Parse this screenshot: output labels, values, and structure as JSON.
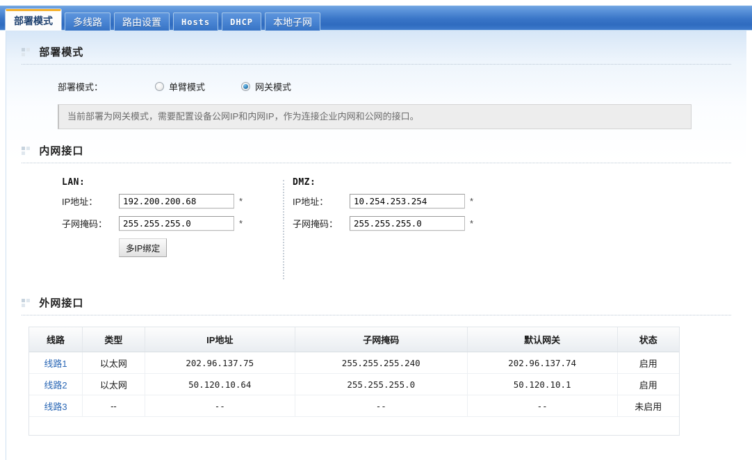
{
  "tabs": [
    {
      "label": "部署模式",
      "active": true,
      "ascii": false
    },
    {
      "label": "多线路",
      "active": false,
      "ascii": false
    },
    {
      "label": "路由设置",
      "active": false,
      "ascii": false
    },
    {
      "label": "Hosts",
      "active": false,
      "ascii": true
    },
    {
      "label": "DHCP",
      "active": false,
      "ascii": true
    },
    {
      "label": "本地子网",
      "active": false,
      "ascii": false
    }
  ],
  "sections": {
    "deploy": {
      "title": "部署模式"
    },
    "lan_section": {
      "title": "内网接口"
    },
    "wan_section": {
      "title": "外网接口"
    }
  },
  "deploy": {
    "label": "部署模式：",
    "options": [
      {
        "label": "单臂模式",
        "selected": false
      },
      {
        "label": "网关模式",
        "selected": true
      }
    ],
    "note": "当前部署为网关模式，需要配置设备公网IP和内网IP，作为连接企业内网和公网的接口。"
  },
  "interfaces": {
    "lan": {
      "title": "LAN:",
      "ip_label": "IP地址：",
      "ip_value": "192.200.200.68",
      "mask_label": "子网掩码：",
      "mask_value": "255.255.255.0",
      "required_mark": "*",
      "button_label": "多IP绑定"
    },
    "dmz": {
      "title": "DMZ:",
      "ip_label": "IP地址：",
      "ip_value": "10.254.253.254",
      "mask_label": "子网掩码：",
      "mask_value": "255.255.255.0",
      "required_mark": "*"
    }
  },
  "wan_table": {
    "headers": [
      "线路",
      "类型",
      "IP地址",
      "子网掩码",
      "默认网关",
      "状态"
    ],
    "rows": [
      {
        "line": "线路1",
        "type": "以太网",
        "ip": "202.96.137.75",
        "mask": "255.255.255.240",
        "gateway": "202.96.137.74",
        "status": "启用",
        "enabled": true
      },
      {
        "line": "线路2",
        "type": "以太网",
        "ip": "50.120.10.64",
        "mask": "255.255.255.0",
        "gateway": "50.120.10.1",
        "status": "启用",
        "enabled": true
      },
      {
        "line": "线路3",
        "type": "--",
        "ip": "--",
        "mask": "--",
        "gateway": "--",
        "status": "未启用",
        "enabled": false
      }
    ]
  },
  "colors": {
    "accent_tab": "#f6b12b",
    "tab_blue": "#3572c4",
    "link": "#2a67b5",
    "status_on": "#0f8f22",
    "status_off": "#8d8d8d"
  }
}
